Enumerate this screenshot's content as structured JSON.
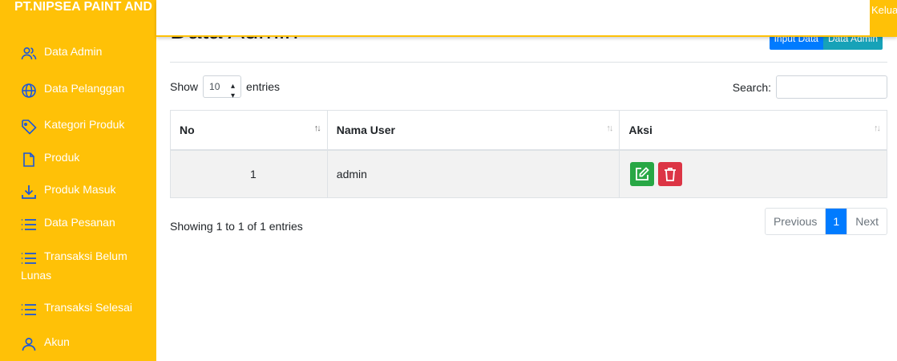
{
  "brand": {
    "title": "PT.NIPSEA PAINT AND C"
  },
  "topbar": {
    "logout_label": "Keluar"
  },
  "sidebar": {
    "items": [
      {
        "label": "Data Admin",
        "icon": "users-icon"
      },
      {
        "label": "Data Pelanggan",
        "icon": "globe-icon"
      },
      {
        "label": "Kategori Produk",
        "icon": "tag-icon"
      },
      {
        "label": "Produk",
        "icon": "file-icon"
      },
      {
        "label": "Produk Masuk",
        "icon": "download-icon"
      },
      {
        "label": "Data Pesanan",
        "icon": "list-icon"
      },
      {
        "label": "Transaksi Belum",
        "label2": "Lunas",
        "icon": "list-icon"
      },
      {
        "label": "Transaksi Selesai",
        "icon": "list-icon"
      },
      {
        "label": "Akun",
        "icon": "user-icon"
      }
    ]
  },
  "main": {
    "title": "Data Admin",
    "buttons": {
      "input": "Input Data",
      "admin": "Data Admin"
    },
    "length": {
      "prefix": "Show",
      "value": "10",
      "suffix": "entries"
    },
    "search": {
      "label": "Search:"
    },
    "table": {
      "headers": [
        "No",
        "Nama User",
        "Aksi"
      ],
      "rows": [
        {
          "no": "1",
          "nama": "admin"
        }
      ]
    },
    "info": "Showing 1 to 1 of 1 entries",
    "pagination": {
      "previous": "Previous",
      "current": "1",
      "next": "Next"
    }
  },
  "colors": {
    "sidebar": "#ffc107",
    "primary": "#007bff",
    "info": "#17a2b8",
    "success": "#28a745",
    "danger": "#dc3545"
  }
}
